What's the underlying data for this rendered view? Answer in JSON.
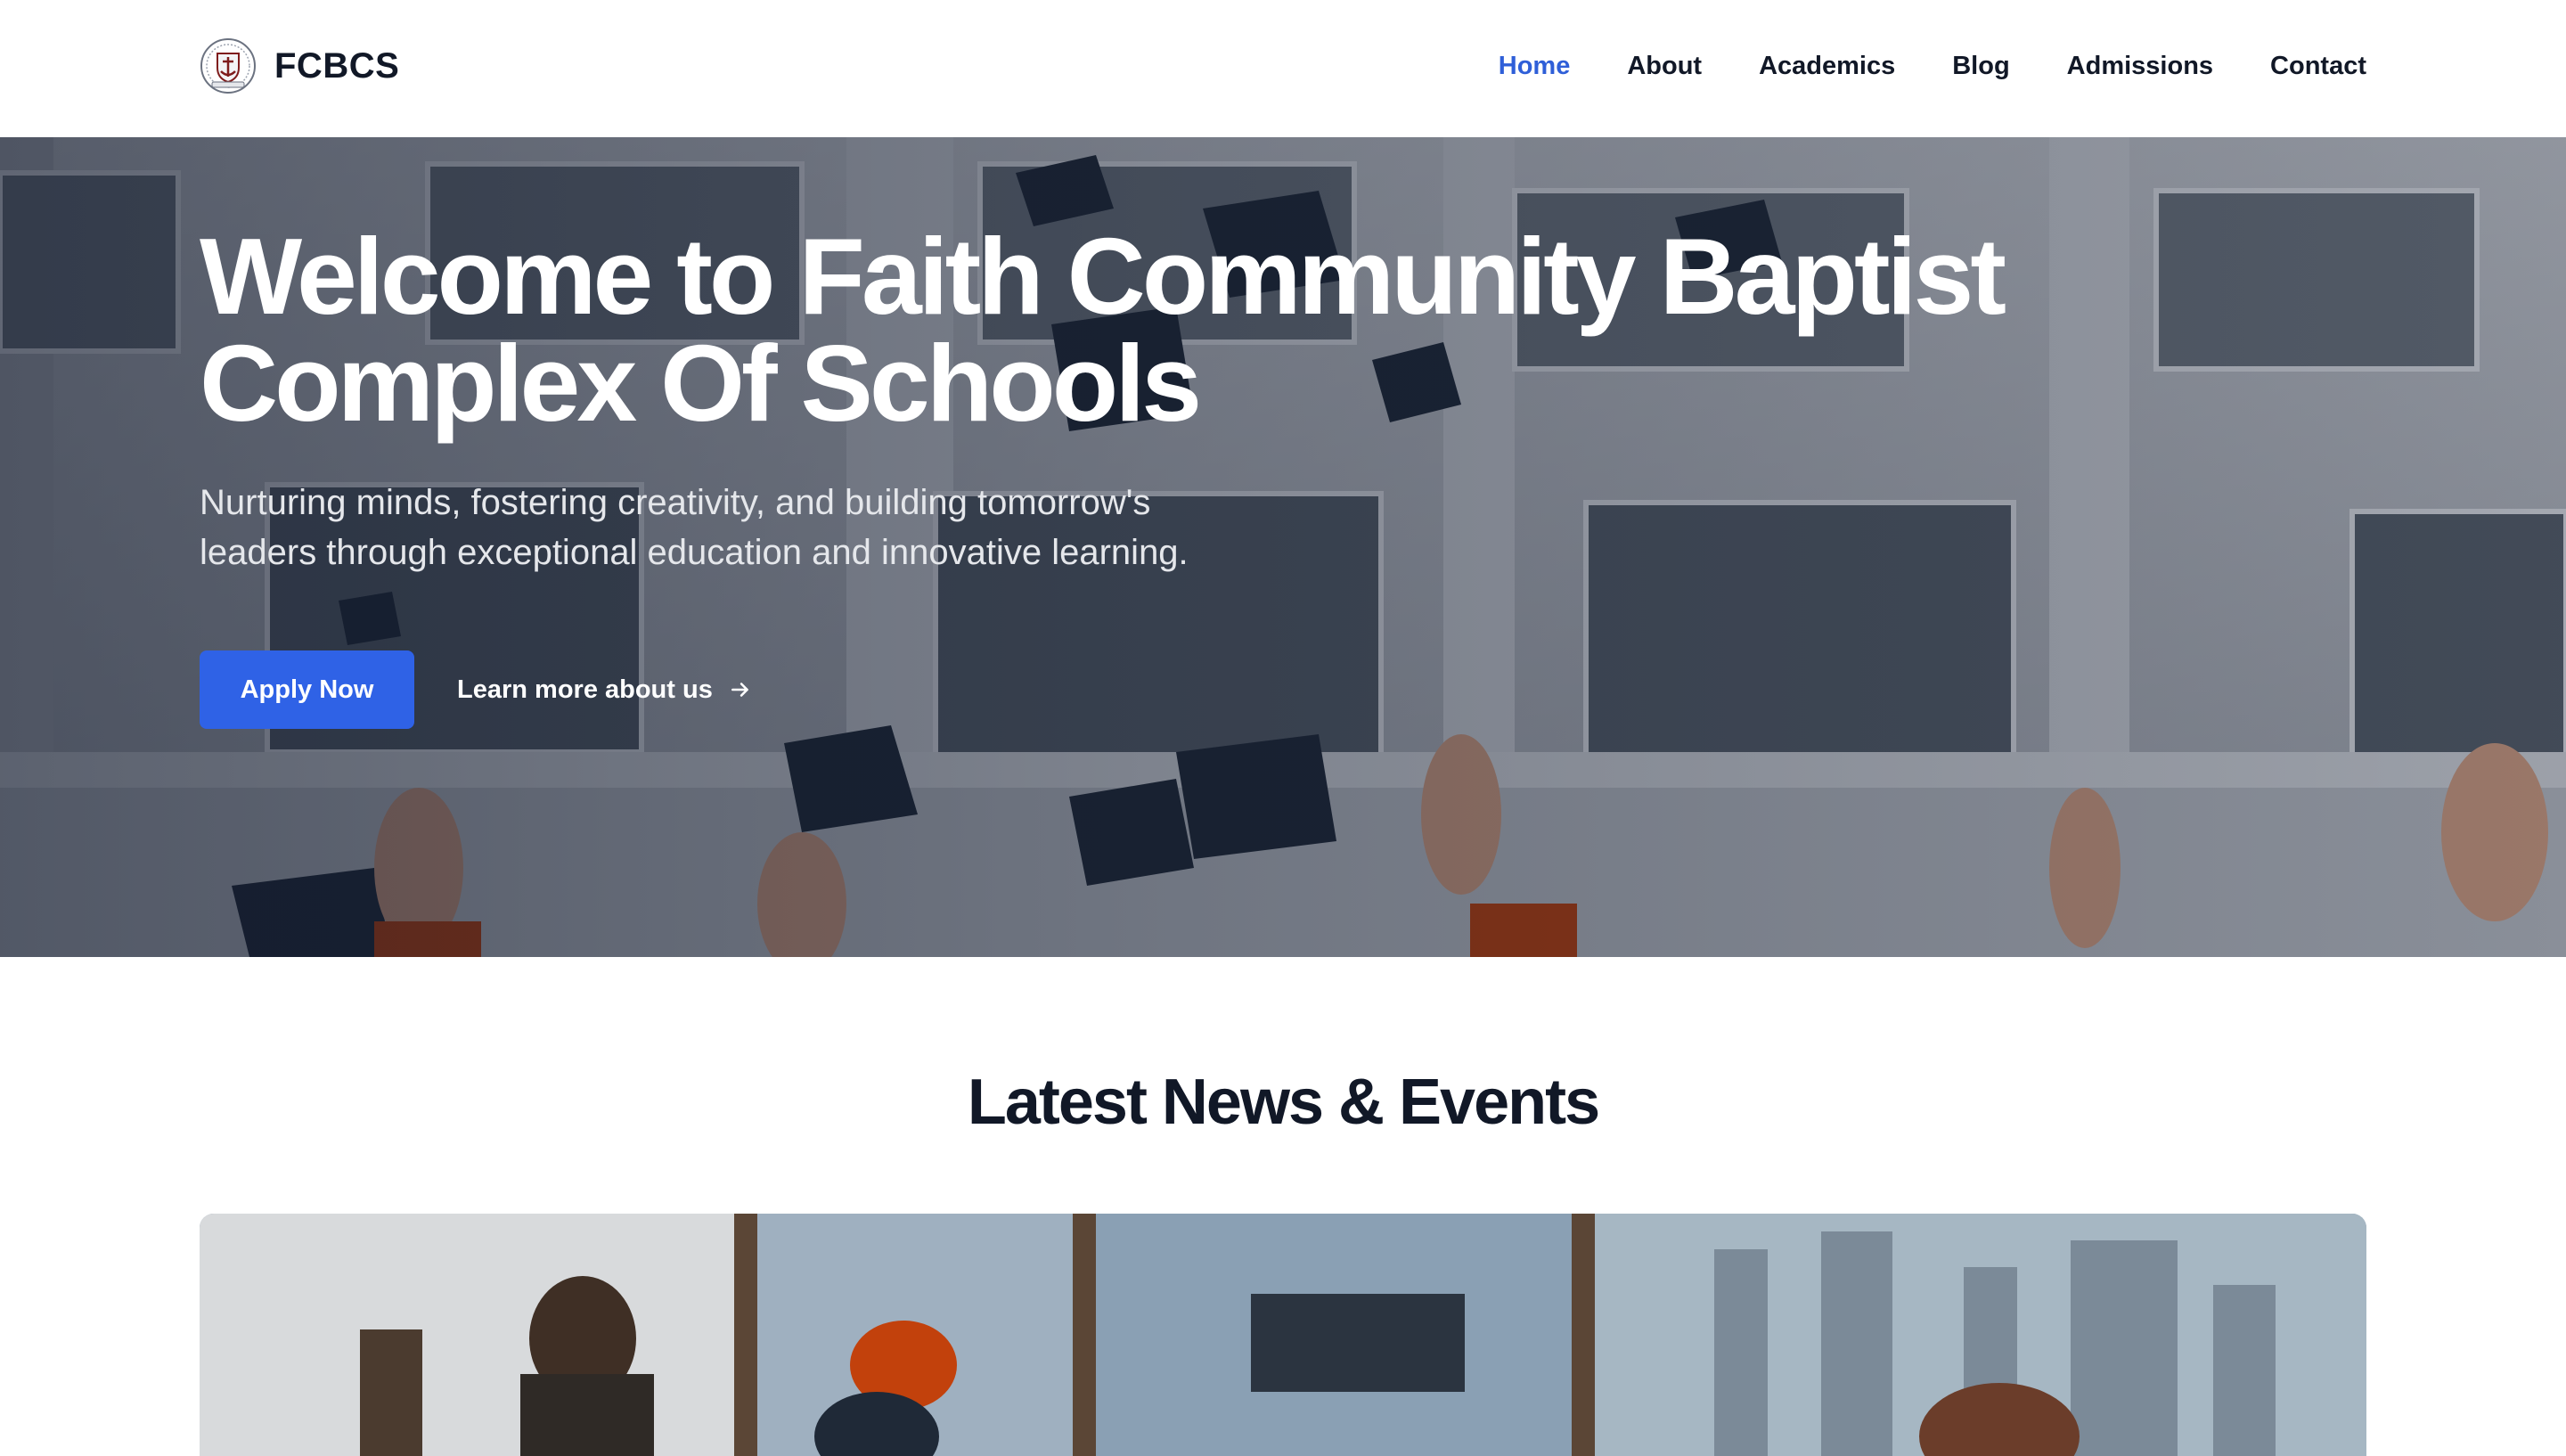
{
  "brand": {
    "name": "FCBCS",
    "logo_icon": "school-crest-anchor-icon"
  },
  "nav": {
    "items": [
      {
        "label": "Home",
        "active": true
      },
      {
        "label": "About",
        "active": false
      },
      {
        "label": "Academics",
        "active": false
      },
      {
        "label": "Blog",
        "active": false
      },
      {
        "label": "Admissions",
        "active": false
      },
      {
        "label": "Contact",
        "active": false
      }
    ]
  },
  "hero": {
    "title": "Welcome to Faith Community Baptist Complex Of Schools",
    "subtitle": "Nurturing minds, fostering creativity, and building tomorrow's leaders through exceptional education and innovative learning.",
    "primary_cta": "Apply Now",
    "secondary_cta": "Learn more about us",
    "secondary_cta_icon": "arrow-right-icon"
  },
  "news": {
    "title": "Latest News & Events"
  },
  "colors": {
    "accent": "#2f62e6",
    "nav_active": "#2f5fd8",
    "text": "#111827"
  }
}
